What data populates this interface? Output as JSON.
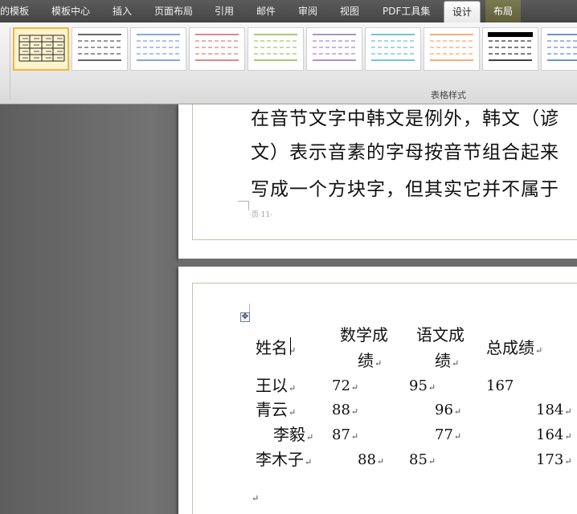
{
  "ribbon": {
    "tabs": [
      {
        "label": "的模板",
        "active": false
      },
      {
        "label": "模板中心",
        "active": false
      },
      {
        "label": "插入",
        "active": false
      },
      {
        "label": "页面布局",
        "active": false
      },
      {
        "label": "引用",
        "active": false
      },
      {
        "label": "邮件",
        "active": false
      },
      {
        "label": "审阅",
        "active": false
      },
      {
        "label": "视图",
        "active": false
      },
      {
        "label": "PDF工具集",
        "active": false
      },
      {
        "label": "设计",
        "active": true
      },
      {
        "label": "布局",
        "active": false
      }
    ],
    "group_label": "表格样式",
    "table_styles": [
      {
        "name": "grid-black",
        "line_color": "#222222",
        "selected": true
      },
      {
        "name": "light-shading",
        "line_color": "#333333",
        "selected": false
      },
      {
        "name": "light-shading-blue",
        "line_color": "#5b8ad3",
        "selected": false
      },
      {
        "name": "light-shading-red",
        "line_color": "#d26060",
        "selected": false
      },
      {
        "name": "light-shading-green",
        "line_color": "#86b84a",
        "selected": false
      },
      {
        "name": "light-shading-purple",
        "line_color": "#8d72b6",
        "selected": false
      },
      {
        "name": "light-shading-aqua",
        "line_color": "#45b2c9",
        "selected": false
      },
      {
        "name": "light-shading-orange",
        "line_color": "#f0904a",
        "selected": false
      },
      {
        "name": "light-list-black",
        "line_color": "#000000",
        "selected": false
      },
      {
        "name": "light-list-blue",
        "line_color": "#3f6fbf",
        "selected": false
      }
    ]
  },
  "document": {
    "page1_lines": [
      "在音节文字中韩文是例外，韩文（谚",
      "文）表示音素的字母按音节组合起来",
      "写成一个方块字，但其实它并不属于"
    ],
    "page1_footer": "·页·11·",
    "table": {
      "headers": [
        "姓名",
        "数学成",
        "绩",
        "语文成",
        "绩",
        "总成绩"
      ],
      "rows": [
        {
          "name": "王以",
          "math": "72",
          "chinese": "95",
          "total": "167"
        },
        {
          "name": "青云",
          "math": "88",
          "chinese": "96",
          "total": "184"
        },
        {
          "name": "李毅",
          "math": "87",
          "chinese": "77",
          "total": "164"
        },
        {
          "name": "李木子",
          "math": "88",
          "chinese": "85",
          "total": "173"
        }
      ]
    },
    "paragraph_mark": "↵",
    "move_handle": "✥"
  }
}
